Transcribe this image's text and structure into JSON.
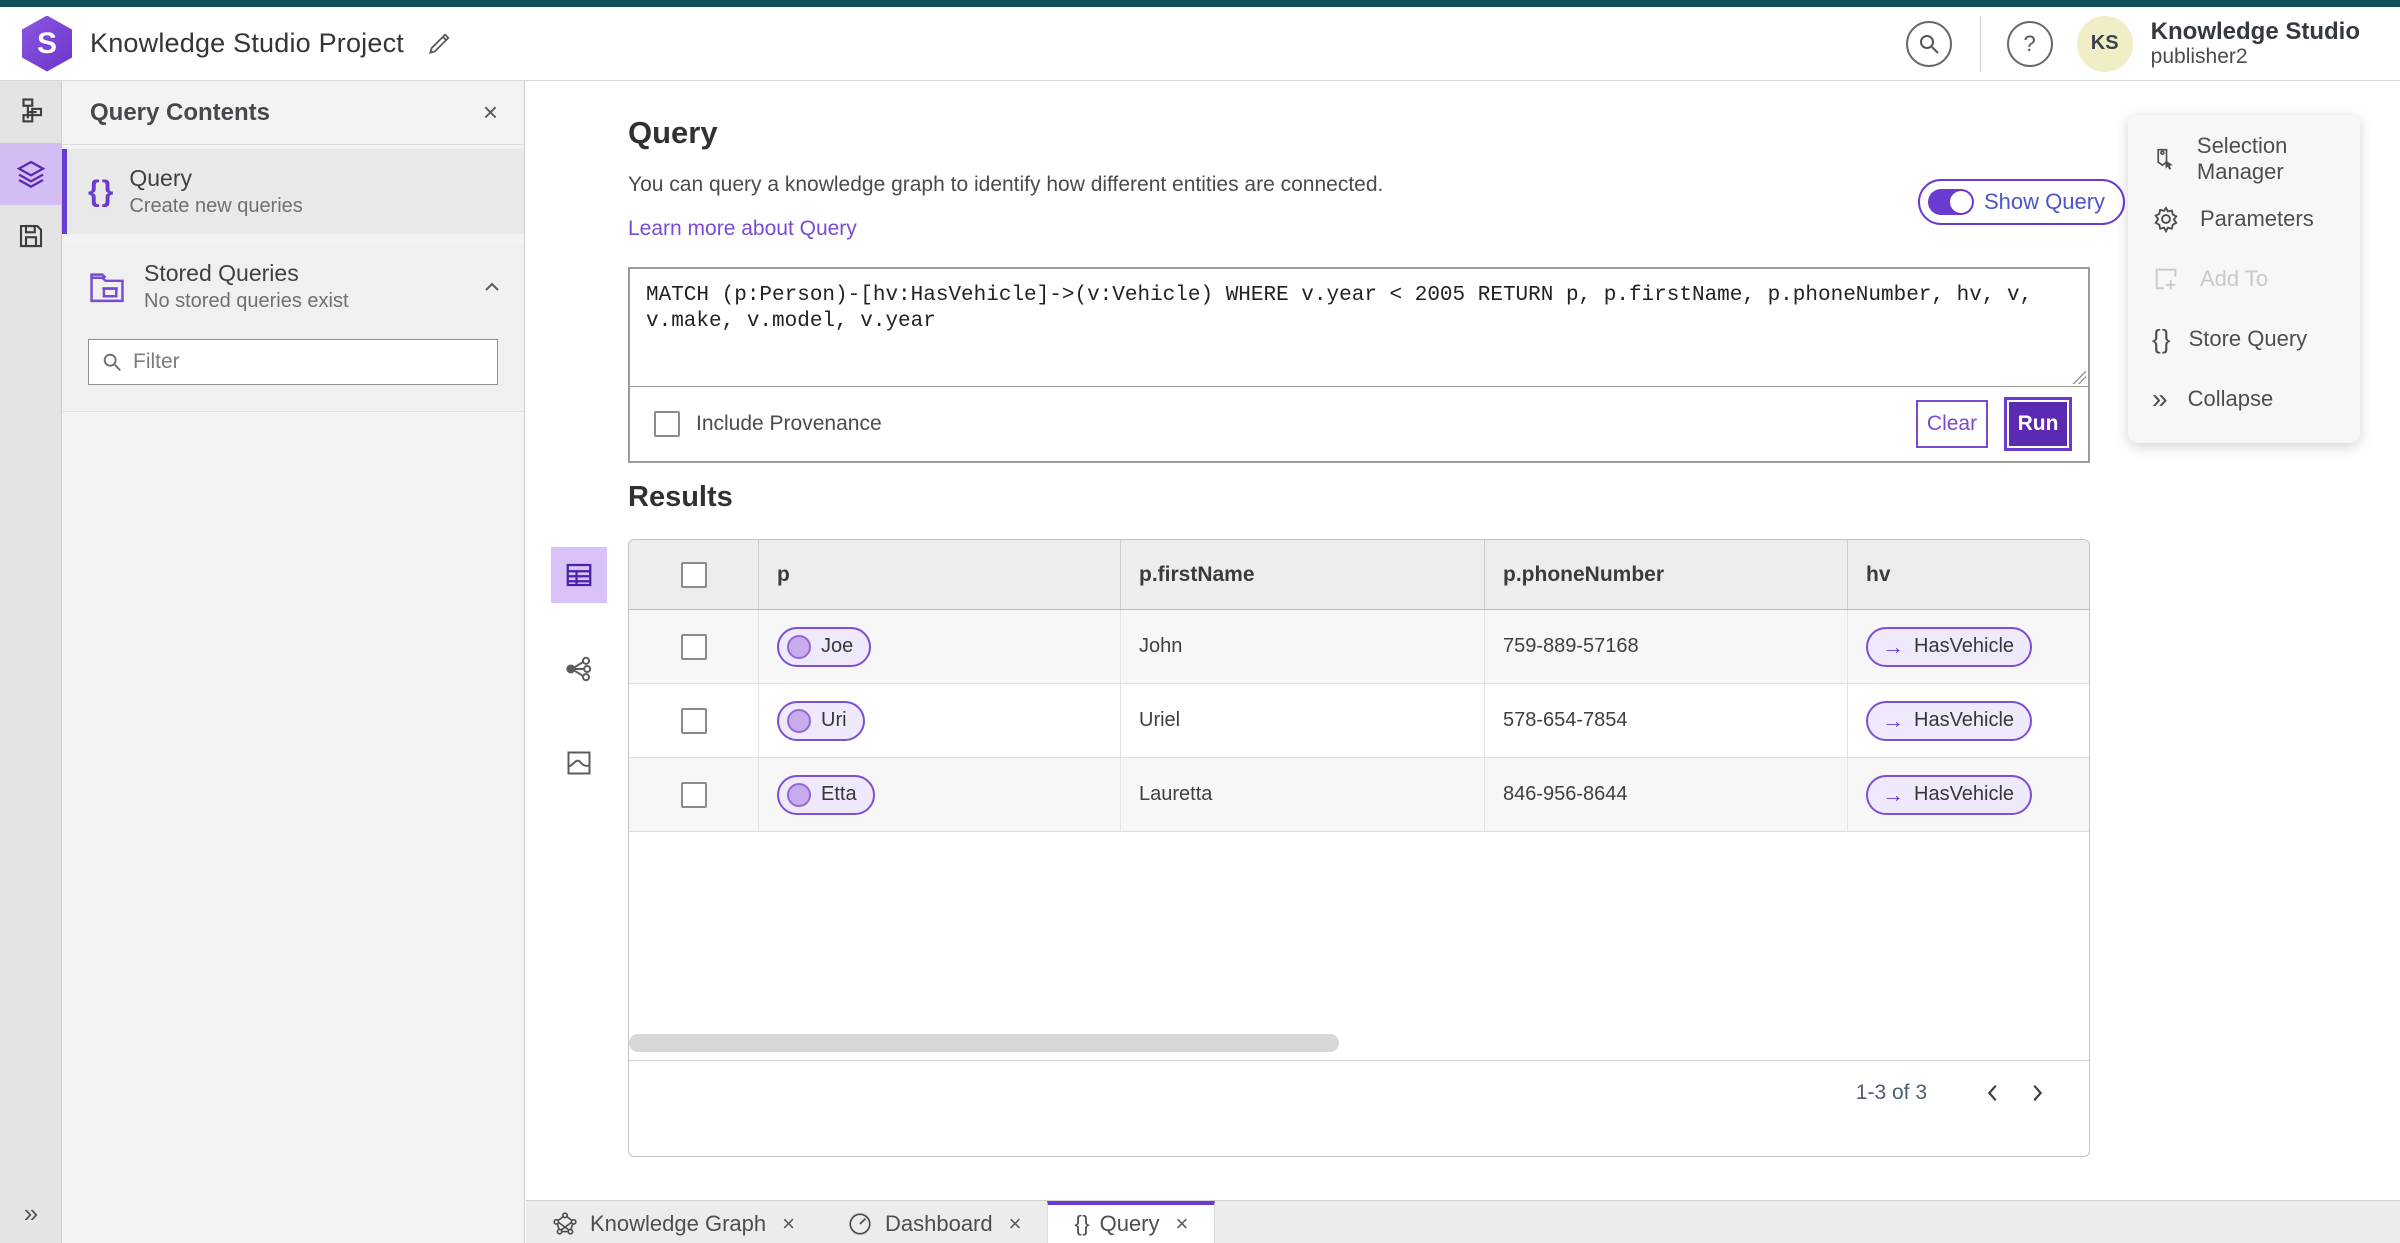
{
  "colors": {
    "accent": "#6a3bd1",
    "accent_deep": "#5a2bb0",
    "teal_bar": "#114f5a",
    "rail_active_bg": "#d4bcf4"
  },
  "header": {
    "app_title": "Knowledge Studio Project",
    "user_name": "Knowledge Studio",
    "user_role": "publisher2",
    "avatar_initials": "KS"
  },
  "contents_panel": {
    "title": "Query Contents",
    "items": [
      {
        "title": "Query",
        "subtitle": "Create new queries"
      },
      {
        "title": "Stored Queries",
        "subtitle": "No stored queries exist"
      }
    ],
    "filter_placeholder": "Filter"
  },
  "query_section": {
    "title": "Query",
    "description": "You can query a knowledge graph to identify how different entities are connected.",
    "learn_more": "Learn more about Query",
    "show_query_label": "Show Query",
    "query_text": "MATCH (p:Person)-[hv:HasVehicle]->(v:Vehicle) WHERE v.year < 2005 RETURN p, p.firstName, p.phoneNumber, hv, v,\nv.make, v.model, v.year",
    "include_provenance_label": "Include Provenance",
    "clear_label": "Clear",
    "run_label": "Run"
  },
  "results": {
    "title": "Results",
    "columns": [
      "p",
      "p.firstName",
      "p.phoneNumber",
      "hv"
    ],
    "rows": [
      {
        "p": "Joe",
        "firstName": "John",
        "phoneNumber": "759-889-57168",
        "hv": "HasVehicle"
      },
      {
        "p": "Uri",
        "firstName": "Uriel",
        "phoneNumber": "578-654-7854",
        "hv": "HasVehicle"
      },
      {
        "p": "Etta",
        "firstName": "Lauretta",
        "phoneNumber": "846-956-8644",
        "hv": "HasVehicle"
      }
    ],
    "pagination": "1-3 of 3"
  },
  "actions_menu": {
    "items": [
      {
        "label": "Selection Manager",
        "disabled": false
      },
      {
        "label": "Parameters",
        "disabled": false
      },
      {
        "label": "Add To",
        "disabled": true
      },
      {
        "label": "Store Query",
        "disabled": false
      },
      {
        "label": "Collapse",
        "disabled": false
      }
    ]
  },
  "tabs": [
    {
      "label": "Knowledge Graph",
      "active": false
    },
    {
      "label": "Dashboard",
      "active": false
    },
    {
      "label": "Query",
      "active": true
    }
  ]
}
